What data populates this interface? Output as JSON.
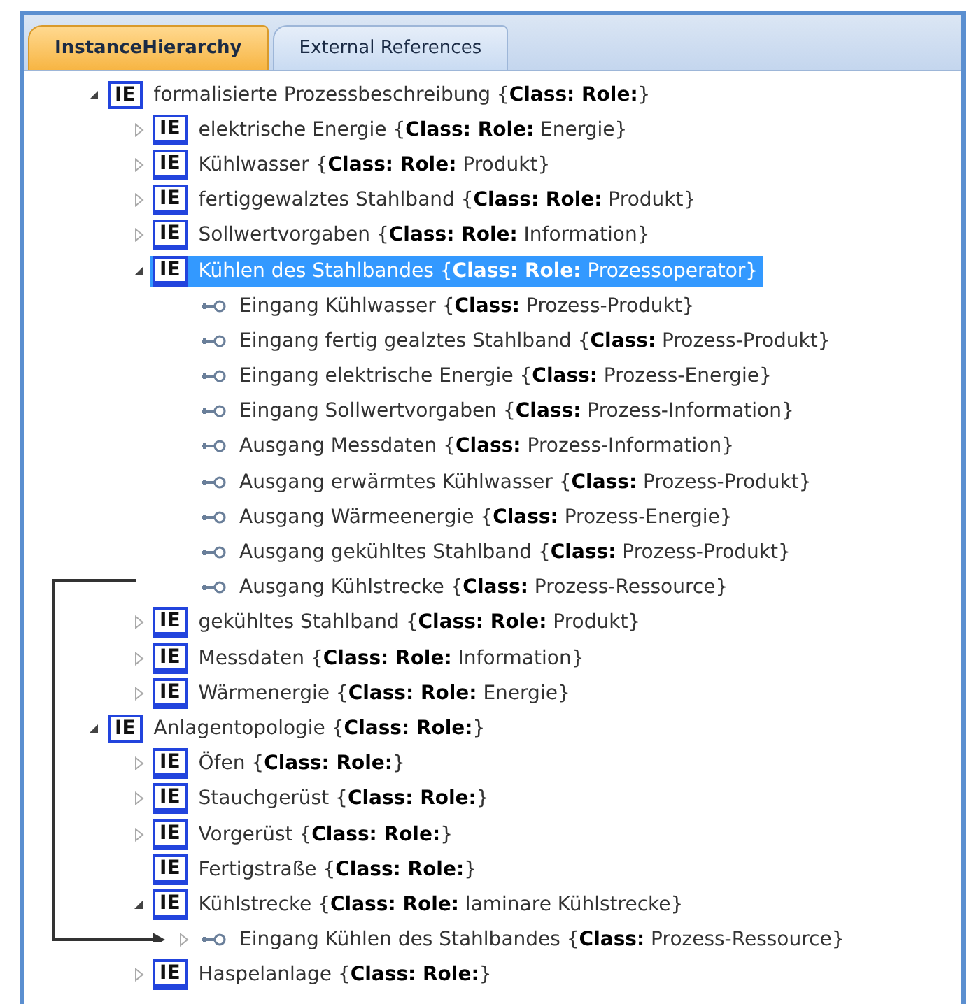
{
  "tabs": [
    {
      "label": "InstanceHierarchy",
      "selected": true
    },
    {
      "label": "External References",
      "selected": false
    }
  ],
  "tree": [
    {
      "kind": "element",
      "badge": "IE",
      "label": "formalisierte Prozessbeschreibung {**Class: Role:**}",
      "expanded": true,
      "selected": false,
      "children": [
        {
          "kind": "element",
          "badge": "IE",
          "label": "elektrische Energie {**Class: Role:** Energie}",
          "expanded": false,
          "selected": false
        },
        {
          "kind": "element",
          "badge": "IE",
          "label": "Kühlwasser {**Class: Role:** Produkt}",
          "expanded": false,
          "selected": false
        },
        {
          "kind": "element",
          "badge": "IE",
          "label": "fertiggewalztes Stahlband {**Class: Role:** Produkt}",
          "expanded": false,
          "selected": false
        },
        {
          "kind": "element",
          "badge": "IE",
          "label": "Sollwertvorgaben {**Class: Role:** Information}",
          "expanded": false,
          "selected": false
        },
        {
          "kind": "element",
          "badge": "IE",
          "label": "Kühlen des Stahlbandes {**Class: Role:** Prozessoperator}",
          "expanded": true,
          "selected": true,
          "children": [
            {
              "kind": "interface",
              "label": "Eingang Kühlwasser {**Class:** Prozess-Produkt}",
              "selected": false
            },
            {
              "kind": "interface",
              "label": "Eingang fertig gealztes Stahlband {**Class:** Prozess-Produkt}",
              "selected": false
            },
            {
              "kind": "interface",
              "label": "Eingang elektrische Energie {**Class:** Prozess-Energie}",
              "selected": false
            },
            {
              "kind": "interface",
              "label": "Eingang Sollwertvorgaben {**Class:** Prozess-Information}",
              "selected": false
            },
            {
              "kind": "interface",
              "label": "Ausgang Messdaten {**Class:** Prozess-Information}",
              "selected": false
            },
            {
              "kind": "interface",
              "label": "Ausgang erwärmtes Kühlwasser {**Class:** Prozess-Produkt}",
              "selected": false
            },
            {
              "kind": "interface",
              "label": "Ausgang Wärmeenergie {**Class:** Prozess-Energie}",
              "selected": false
            },
            {
              "kind": "interface",
              "label": "Ausgang gekühltes Stahlband {**Class:** Prozess-Produkt}",
              "selected": false
            },
            {
              "kind": "interface",
              "label": "Ausgang Kühlstrecke {**Class:** Prozess-Ressource}",
              "selected": false
            }
          ]
        },
        {
          "kind": "element",
          "badge": "IE",
          "label": "gekühltes Stahlband {**Class: Role:** Produkt}",
          "expanded": false,
          "selected": false
        },
        {
          "kind": "element",
          "badge": "IE",
          "label": "Messdaten {**Class: Role:** Information}",
          "expanded": false,
          "selected": false
        },
        {
          "kind": "element",
          "badge": "IE",
          "label": "Wärmenergie {**Class: Role:** Energie}",
          "expanded": false,
          "selected": false
        }
      ]
    },
    {
      "kind": "element",
      "badge": "IE",
      "label": "Anlagentopologie {**Class: Role:**}",
      "expanded": true,
      "selected": false,
      "children": [
        {
          "kind": "element",
          "badge": "IE",
          "label": "Öfen {**Class: Role:**}",
          "expanded": false,
          "selected": false
        },
        {
          "kind": "element",
          "badge": "IE",
          "label": "Stauchgerüst {**Class: Role:**}",
          "expanded": false,
          "selected": false
        },
        {
          "kind": "element",
          "badge": "IE",
          "label": "Vorgerüst {**Class: Role:**}",
          "expanded": false,
          "selected": false
        },
        {
          "kind": "element",
          "badge": "IE",
          "label": "Fertigstraße {**Class: Role:**}",
          "selected": false
        },
        {
          "kind": "element",
          "badge": "IE",
          "label": "Kühlstrecke {**Class: Role:** laminare Kühlstrecke}",
          "expanded": true,
          "selected": false,
          "children": [
            {
              "kind": "interface",
              "label": "Eingang Kühlen des Stahlbandes {**Class:** Prozess-Ressource}",
              "expanded": false,
              "selected": false
            }
          ]
        },
        {
          "kind": "element",
          "badge": "IE",
          "label": "Haspelanlage {**Class: Role:**}",
          "expanded": false,
          "selected": false
        }
      ]
    }
  ]
}
